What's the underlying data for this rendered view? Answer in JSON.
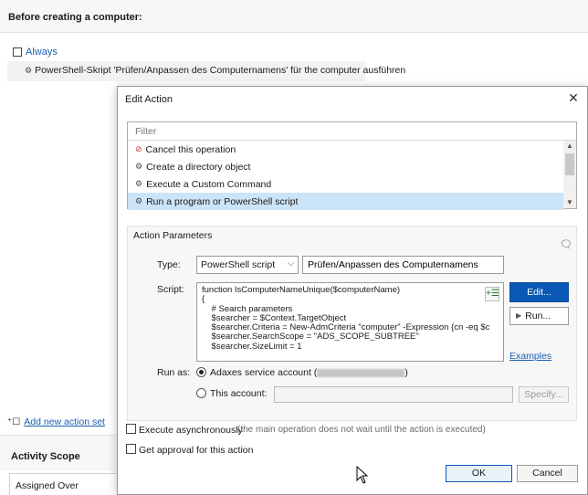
{
  "background": {
    "header_title": "Before creating a computer:",
    "condition_label": "Always",
    "action_text": "PowerShell-Skript 'Prüfen/Anpassen des Computernamens' für the computer ausführen",
    "add_action_link": "Add new action set",
    "activity_scope_title": "Activity Scope",
    "assigned_over": "Assigned Over"
  },
  "dialog": {
    "title": "Edit Action",
    "filter_placeholder": "Filter",
    "action_list": [
      {
        "label": "Cancel this operation",
        "icon": "stop-icon"
      },
      {
        "label": "Create a directory object",
        "icon": "gear-icon"
      },
      {
        "label": "Execute a Custom Command",
        "icon": "gear-icon"
      },
      {
        "label": "Run a program or PowerShell script",
        "icon": "gear-icon",
        "selected": true
      }
    ],
    "params": {
      "title": "Action Parameters",
      "type_label": "Type:",
      "type_value": "PowerShell script",
      "name_value": "Prüfen/Anpassen des Computernamens",
      "script_label": "Script:",
      "script_lines": [
        "function IsComputerNameUnique($computerName)",
        "{",
        "    # Search parameters",
        "    $searcher = $Context.TargetObject",
        "    $searcher.Criteria = New-AdmCriteria \"computer\" -Expression {cn -eq $c",
        "    $searcher.SearchScope = \"ADS_SCOPE_SUBTREE\"",
        "    $searcher.SizeLimit = 1"
      ],
      "edit_button": "Edit...",
      "run_button": "Run...",
      "examples_link": "Examples",
      "run_as_label": "Run as:",
      "service_account_label": "Adaxes service account (",
      "service_account_suffix": ")",
      "this_account_label": "This account:",
      "specify_button": "Specify..."
    },
    "execute_async_label": "Execute asynchronously",
    "execute_async_note": "(the main operation does not wait until the action is executed)",
    "approval_label": "Get approval for this action",
    "ok_button": "OK",
    "cancel_button": "Cancel"
  },
  "colors": {
    "accent": "#0a58b5",
    "selection": "#cce4f7",
    "link": "#1a5fb4"
  }
}
